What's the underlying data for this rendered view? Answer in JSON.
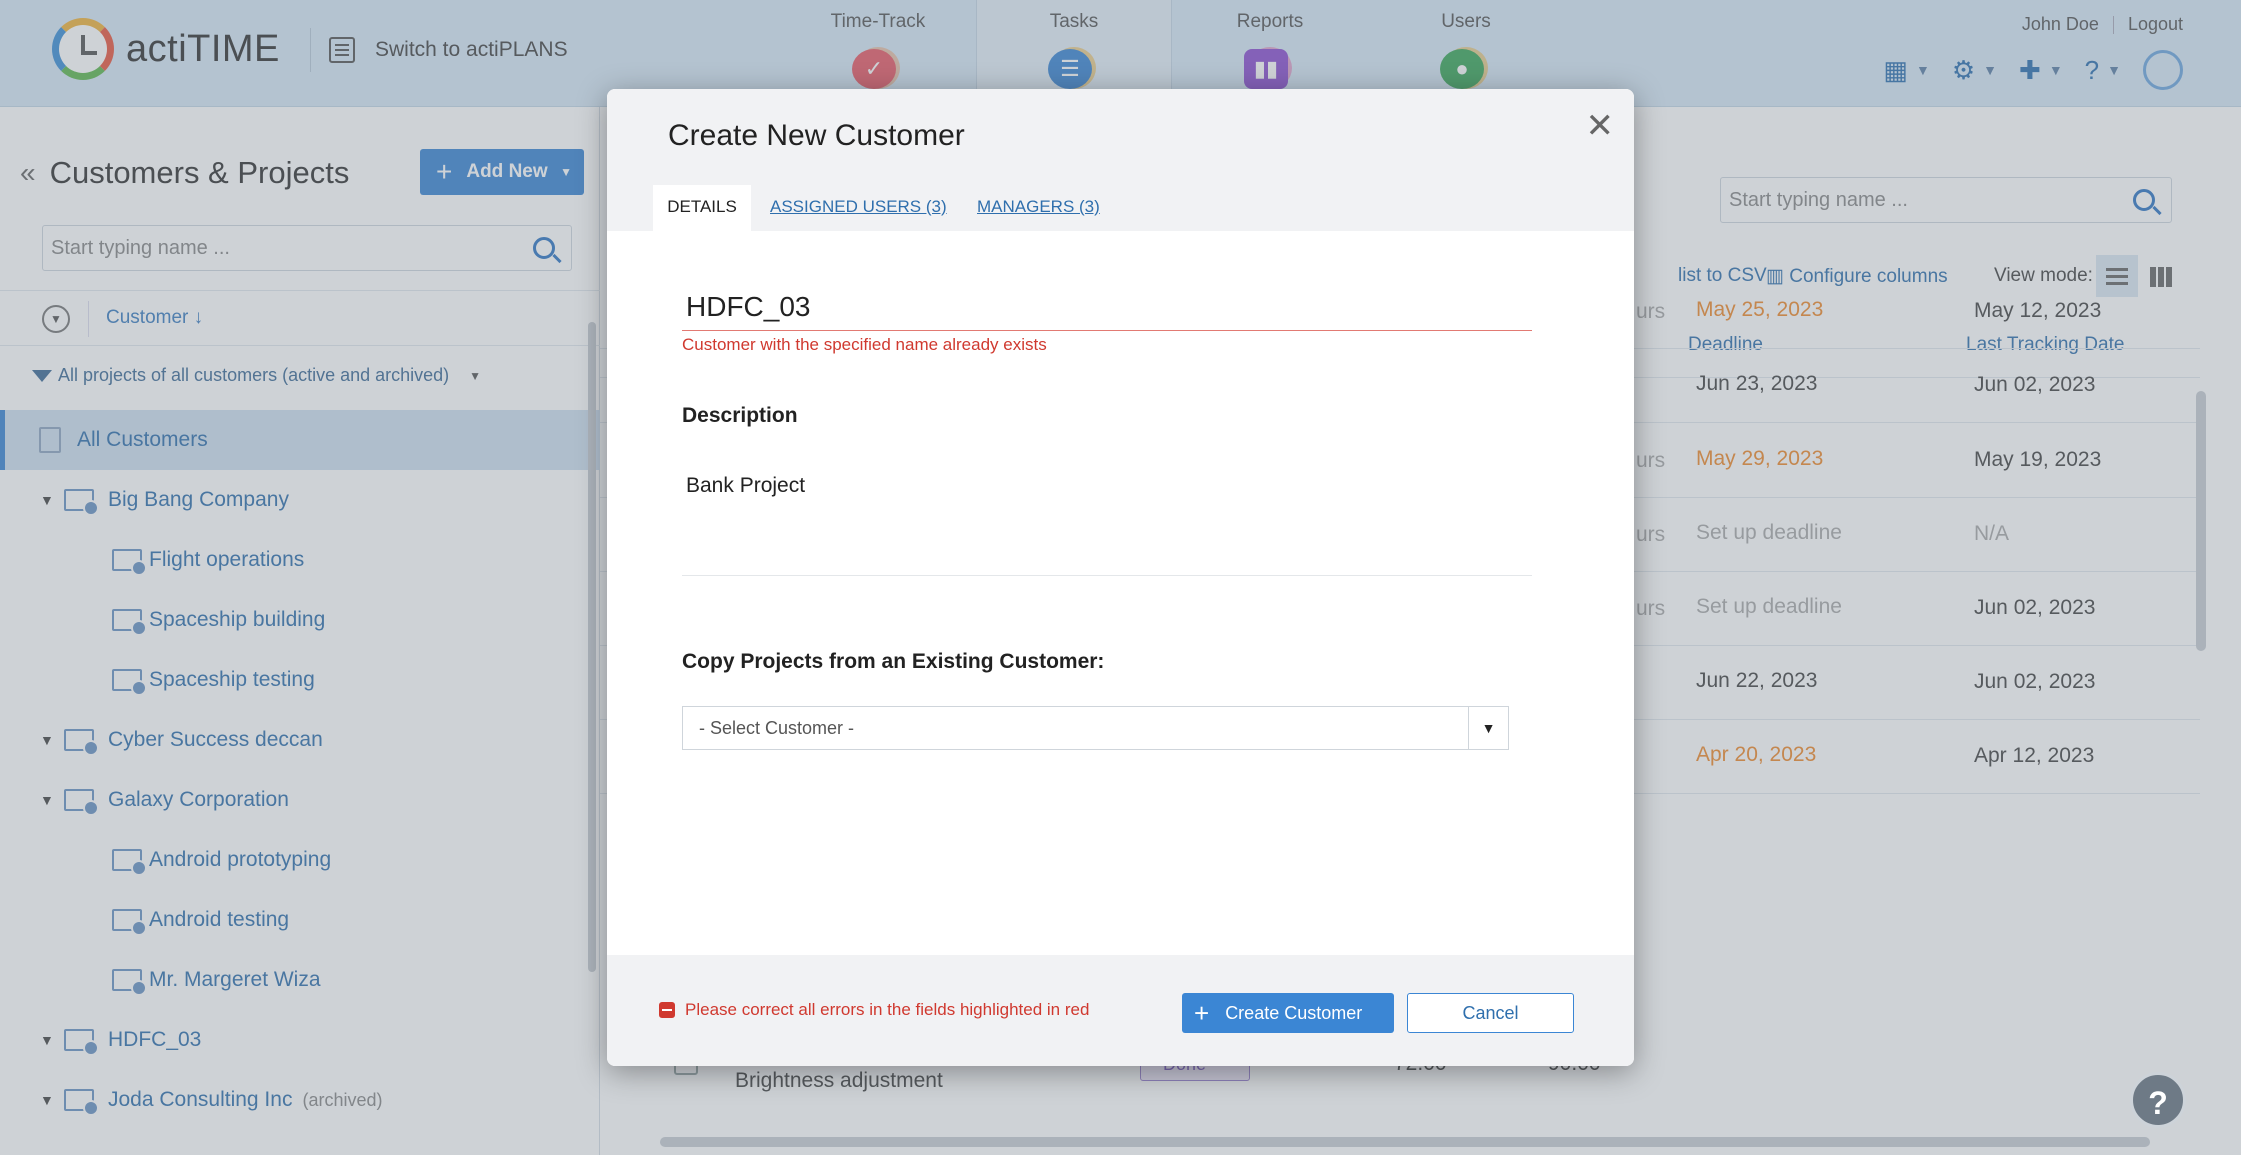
{
  "topbar": {
    "logo_text": "actiTIME",
    "switch_label": "Switch to actiPLANS",
    "nav": [
      {
        "label": "Time-Track",
        "icon": "check-icon",
        "color": "#e85a66"
      },
      {
        "label": "Tasks",
        "icon": "list-icon",
        "color": "#3b86d4"
      },
      {
        "label": "Reports",
        "icon": "chart-icon",
        "color": "#8b4fd1"
      },
      {
        "label": "Users",
        "icon": "user-icon",
        "color": "#3aa65a"
      }
    ],
    "user_name": "John Doe",
    "logout": "Logout"
  },
  "left": {
    "title": "Customers & Projects",
    "add_new": "Add New",
    "search_placeholder": "Start typing name ...",
    "sort_label": "Customer",
    "filter_label": "All projects of all customers (active and archived)",
    "tree": [
      {
        "label": "All Customers",
        "type": "all",
        "selected": true
      },
      {
        "label": "Big Bang Company",
        "type": "customer"
      },
      {
        "label": "Flight operations",
        "type": "project"
      },
      {
        "label": "Spaceship building",
        "type": "project"
      },
      {
        "label": "Spaceship testing",
        "type": "project"
      },
      {
        "label": "Cyber Success deccan",
        "type": "customer"
      },
      {
        "label": "Galaxy Corporation",
        "type": "customer"
      },
      {
        "label": "Android prototyping",
        "type": "project"
      },
      {
        "label": "Android testing",
        "type": "project"
      },
      {
        "label": "Mr. Margeret Wiza",
        "type": "project"
      },
      {
        "label": "HDFC_03",
        "type": "customer"
      },
      {
        "label": "Joda Consulting Inc",
        "type": "customer",
        "tag": "(archived)"
      }
    ]
  },
  "right": {
    "search_placeholder": "Start typing name ...",
    "export_label": "list to CSV",
    "configure_label": "Configure columns",
    "view_mode_label": "View mode:",
    "columns": {
      "deadline": "Deadline",
      "last_tracking": "Last Tracking Date"
    },
    "rows": [
      {
        "partial": "urs",
        "deadline": "May 25, 2023",
        "deadline_style": "orange",
        "last": "May 12, 2023",
        "last_style": ""
      },
      {
        "partial": "",
        "deadline": "Jun 23, 2023",
        "deadline_style": "",
        "last": "Jun 02, 2023",
        "last_style": ""
      },
      {
        "partial": "urs",
        "deadline": "May 29, 2023",
        "deadline_style": "orange",
        "last": "May 19, 2023",
        "last_style": ""
      },
      {
        "partial": "urs",
        "deadline": "Set up deadline",
        "deadline_style": "muted",
        "last": "N/A",
        "last_style": "muted"
      },
      {
        "partial": "urs",
        "deadline": "Set up deadline",
        "deadline_style": "muted",
        "last": "Jun 02, 2023",
        "last_style": ""
      },
      {
        "partial": "",
        "deadline": "Jun 22, 2023",
        "deadline_style": "",
        "last": "Jun 02, 2023",
        "last_style": ""
      },
      {
        "partial": "",
        "deadline": "Apr 20, 2023",
        "deadline_style": "orange",
        "last": "Apr 12, 2023",
        "last_style": ""
      }
    ],
    "last_row_task": "Brightness adjustment",
    "last_row_status": "Done",
    "last_row_num1": "72.00",
    "last_row_num2": "90.00"
  },
  "modal": {
    "title": "Create New Customer",
    "tabs": {
      "details": "DETAILS",
      "assigned": "ASSIGNED USERS (3)",
      "managers": "MANAGERS (3)"
    },
    "name_value": "HDFC_03",
    "name_error": "Customer with the specified name already exists",
    "description_label": "Description",
    "description_value": "Bank Project",
    "copy_label": "Copy Projects from an Existing Customer:",
    "select_value": "- Select Customer -",
    "footer_error": "Please correct all errors in the fields highlighted in red",
    "create_button": "Create Customer",
    "cancel_button": "Cancel"
  }
}
